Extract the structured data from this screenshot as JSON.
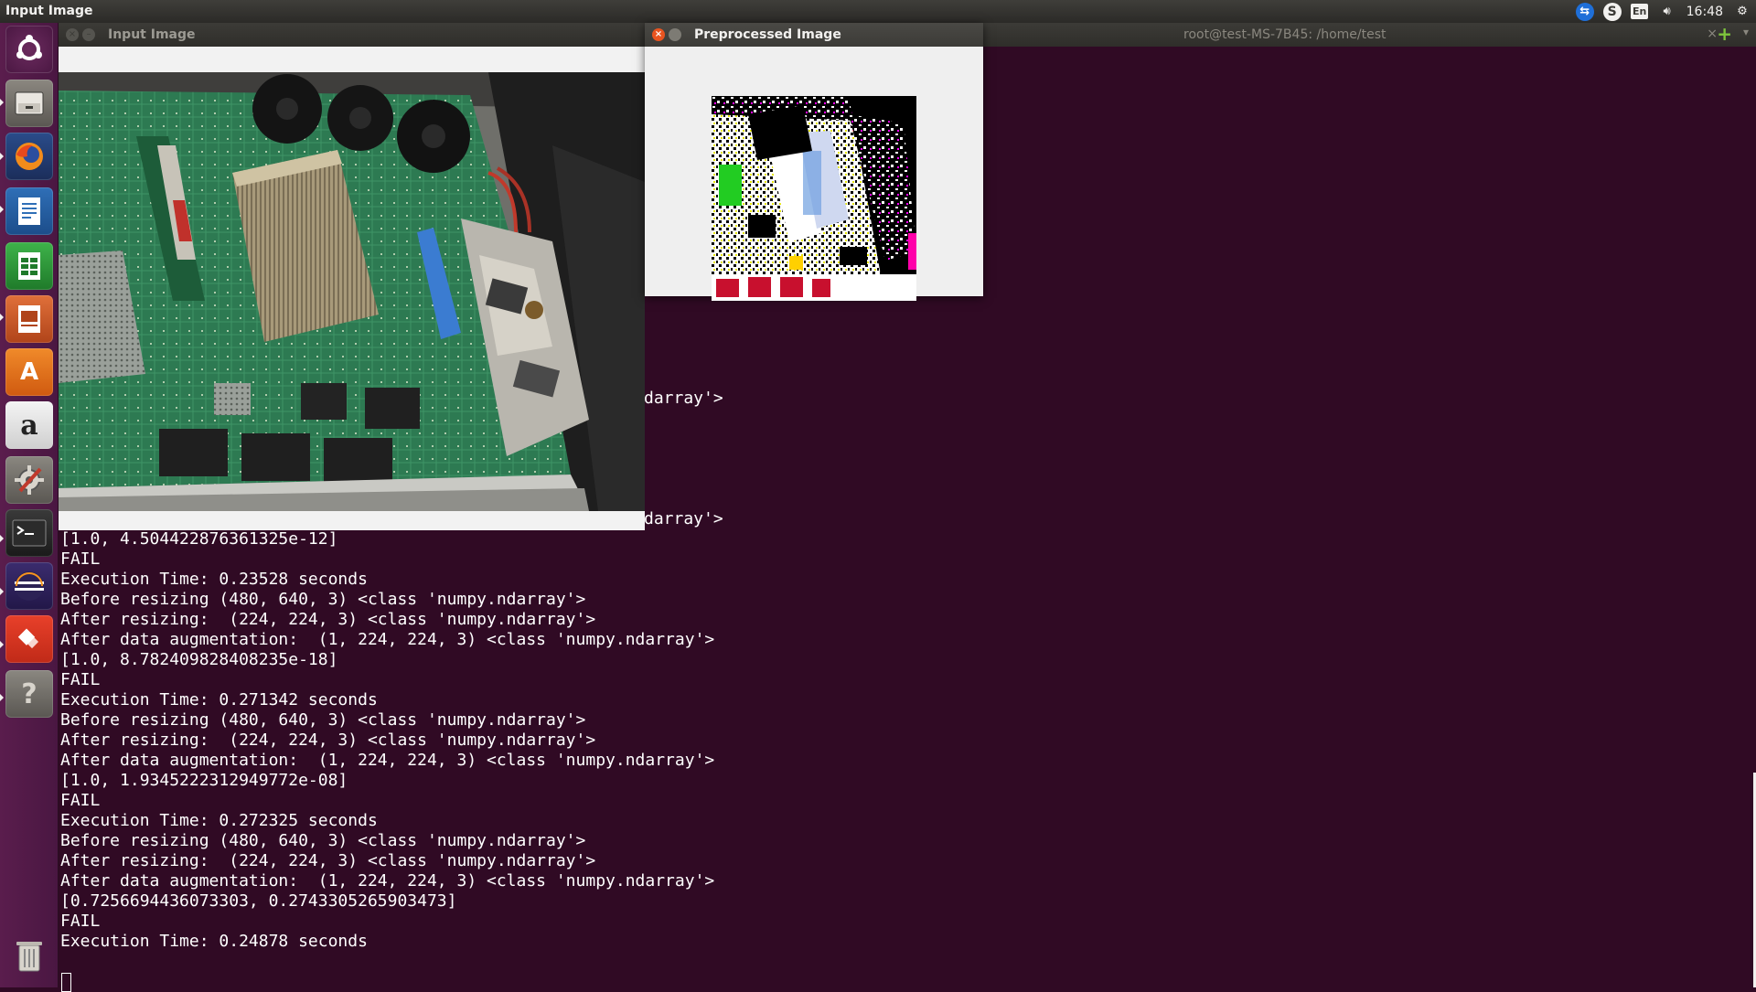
{
  "top_panel": {
    "app_title": "Input Image",
    "keyboard_layout": "En",
    "clock": "16:48",
    "indicators": [
      "teamviewer-icon",
      "skype-icon",
      "keyboard-icon",
      "volume-icon",
      "gear-icon"
    ]
  },
  "launcher": {
    "items": [
      "ubuntu-logo-icon",
      "files-icon",
      "firefox-icon",
      "writer-icon",
      "calc-icon",
      "impress-icon",
      "software-center-icon",
      "amazon-icon",
      "system-settings-icon",
      "terminal-icon",
      "eclipse-icon",
      "anydesk-icon",
      "help-icon",
      "trash-icon"
    ]
  },
  "terminal": {
    "title": "root@test-MS-7B45: /home/test",
    "tab_close": "×",
    "peek_line_1": "darray'>",
    "peek_line_2": "darray'>",
    "output": "[1.0, 4.504422876361325e-12]\nFAIL\nExecution Time: 0.23528 seconds\nBefore resizing (480, 640, 3) <class 'numpy.ndarray'>\nAfter resizing:  (224, 224, 3) <class 'numpy.ndarray'>\nAfter data augmentation:  (1, 224, 224, 3) <class 'numpy.ndarray'>\n[1.0, 8.782409828408235e-18]\nFAIL\nExecution Time: 0.271342 seconds\nBefore resizing (480, 640, 3) <class 'numpy.ndarray'>\nAfter resizing:  (224, 224, 3) <class 'numpy.ndarray'>\nAfter data augmentation:  (1, 224, 224, 3) <class 'numpy.ndarray'>\n[1.0, 1.9345222312949772e-08]\nFAIL\nExecution Time: 0.272325 seconds\nBefore resizing (480, 640, 3) <class 'numpy.ndarray'>\nAfter resizing:  (224, 224, 3) <class 'numpy.ndarray'>\nAfter data augmentation:  (1, 224, 224, 3) <class 'numpy.ndarray'>\n[0.7256694436073303, 0.2743305265903473]\nFAIL\nExecution Time: 0.24878 seconds"
  },
  "input_window": {
    "title": "Input Image"
  },
  "preprocessed_window": {
    "title": "Preprocessed Image",
    "close_glyph": "×"
  },
  "colors": {
    "terminal_bg": "#300a24",
    "accent_orange": "#e95420",
    "launcher_bg": "#5a1d4d"
  }
}
